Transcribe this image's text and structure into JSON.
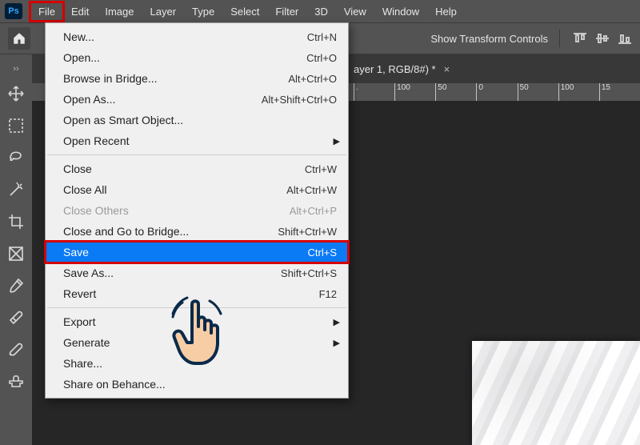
{
  "app": {
    "logo": "Ps"
  },
  "menubar": {
    "items": [
      "File",
      "Edit",
      "Image",
      "Layer",
      "Type",
      "Select",
      "Filter",
      "3D",
      "View",
      "Window",
      "Help"
    ],
    "active_index": 0
  },
  "options": {
    "show_transform": "Show Transform Controls"
  },
  "tab": {
    "title": "ayer 1, RGB/8#) *"
  },
  "ruler": {
    "marks": [
      ".",
      "100",
      "50",
      "0",
      "50",
      "100",
      "15"
    ]
  },
  "tools": [
    "move-tool",
    "marquee-tool",
    "lasso-tool",
    "magic-wand-tool",
    "crop-tool",
    "frame-tool",
    "eyedropper-tool",
    "healing-brush-tool",
    "brush-tool",
    "clone-stamp-tool"
  ],
  "file_menu": {
    "groups": [
      [
        {
          "label": "New...",
          "shortcut": "Ctrl+N"
        },
        {
          "label": "Open...",
          "shortcut": "Ctrl+O"
        },
        {
          "label": "Browse in Bridge...",
          "shortcut": "Alt+Ctrl+O"
        },
        {
          "label": "Open As...",
          "shortcut": "Alt+Shift+Ctrl+O"
        },
        {
          "label": "Open as Smart Object..."
        },
        {
          "label": "Open Recent",
          "submenu": true
        }
      ],
      [
        {
          "label": "Close",
          "shortcut": "Ctrl+W"
        },
        {
          "label": "Close All",
          "shortcut": "Alt+Ctrl+W"
        },
        {
          "label": "Close Others",
          "shortcut": "Alt+Ctrl+P",
          "disabled": true
        },
        {
          "label": "Close and Go to Bridge...",
          "shortcut": "Shift+Ctrl+W"
        },
        {
          "label": "Save",
          "shortcut": "Ctrl+S",
          "highlight": true
        },
        {
          "label": "Save As...",
          "shortcut": "Shift+Ctrl+S"
        },
        {
          "label": "Revert",
          "shortcut": "F12"
        }
      ],
      [
        {
          "label": "Export",
          "submenu": true
        },
        {
          "label": "Generate",
          "submenu": true
        },
        {
          "label": "Share..."
        },
        {
          "label": "Share on Behance..."
        }
      ]
    ]
  }
}
